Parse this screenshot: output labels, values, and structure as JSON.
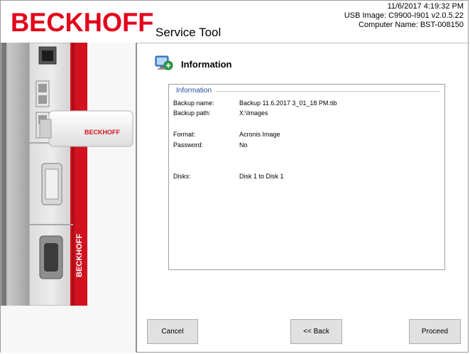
{
  "header": {
    "brand": "BECKHOFF",
    "title": "Service Tool",
    "datetime": "11/6/2017 4:19:32 PM",
    "usb_image": "USB Image: C9900-I901 v2.0.5.22",
    "computer_name": "Computer Name: BST-008150"
  },
  "device_image": {
    "stick_brand": "BECKHOFF",
    "side_brand": "BECKHOFF"
  },
  "section": {
    "heading": "Information",
    "icon": "info-network-icon"
  },
  "info_group": {
    "legend": "Information",
    "rows": [
      {
        "label": "Backup name:",
        "value": "Backup 11.6.2017 3_01_18 PM.tib"
      },
      {
        "label": "Backup path:",
        "value": "X:\\Images"
      },
      {
        "label": "Format:",
        "value": "Acronis Image"
      },
      {
        "label": "Password:",
        "value": "No"
      },
      {
        "label": "Disks:",
        "value": "Disk 1 to Disk 1"
      }
    ]
  },
  "buttons": {
    "cancel": "Cancel",
    "back": "<< Back",
    "proceed": "Proceed"
  },
  "colors": {
    "brand_red": "#e2001a",
    "legend_blue": "#1f4e9c",
    "button_bg": "#e1e1e1"
  }
}
